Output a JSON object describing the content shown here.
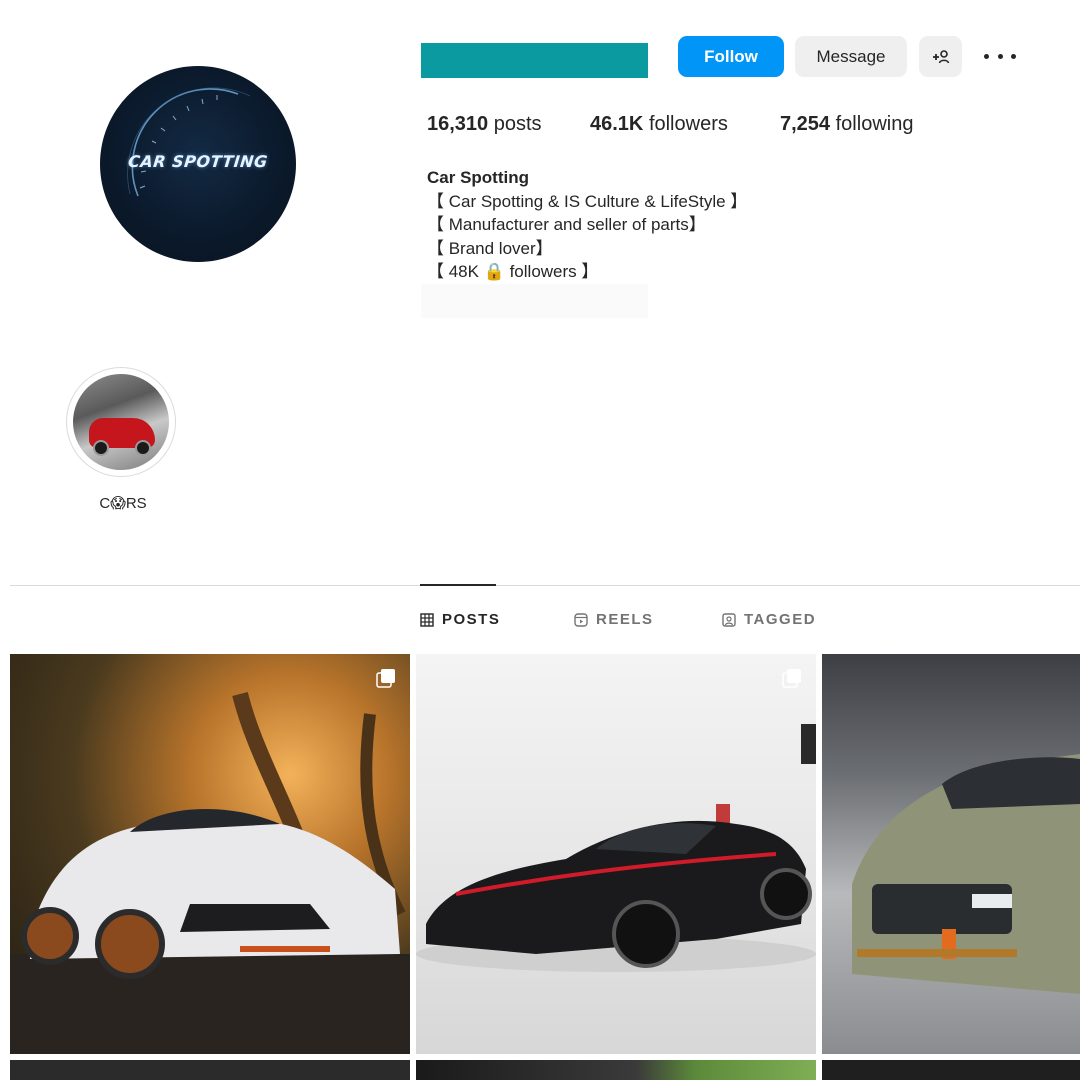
{
  "profile": {
    "avatar_text": "CAR SPOTTING",
    "buttons": {
      "follow": "Follow",
      "message": "Message",
      "add_user": "+"
    },
    "stats": {
      "posts_count": "16,310",
      "posts_label": "posts",
      "followers_count": "46.1K",
      "followers_label": "followers",
      "following_count": "7,254",
      "following_label": "following"
    },
    "bio": {
      "title": "Car Spotting",
      "lines": [
        "【 Car Spotting & IS Culture & LifeStyle 】",
        "【 Manufacturer and seller of parts】",
        "【 Brand lover】",
        "【 48K 🔒 followers 】"
      ]
    }
  },
  "highlights": [
    {
      "label": "C😱RS"
    }
  ],
  "tabs": [
    {
      "label": "POSTS",
      "icon": "grid-icon",
      "active": true
    },
    {
      "label": "REELS",
      "icon": "reels-icon",
      "active": false
    },
    {
      "label": "TAGGED",
      "icon": "tagged-icon",
      "active": false
    }
  ],
  "colors": {
    "accent": "#0095f6",
    "name_block": "#0a9a9f"
  }
}
